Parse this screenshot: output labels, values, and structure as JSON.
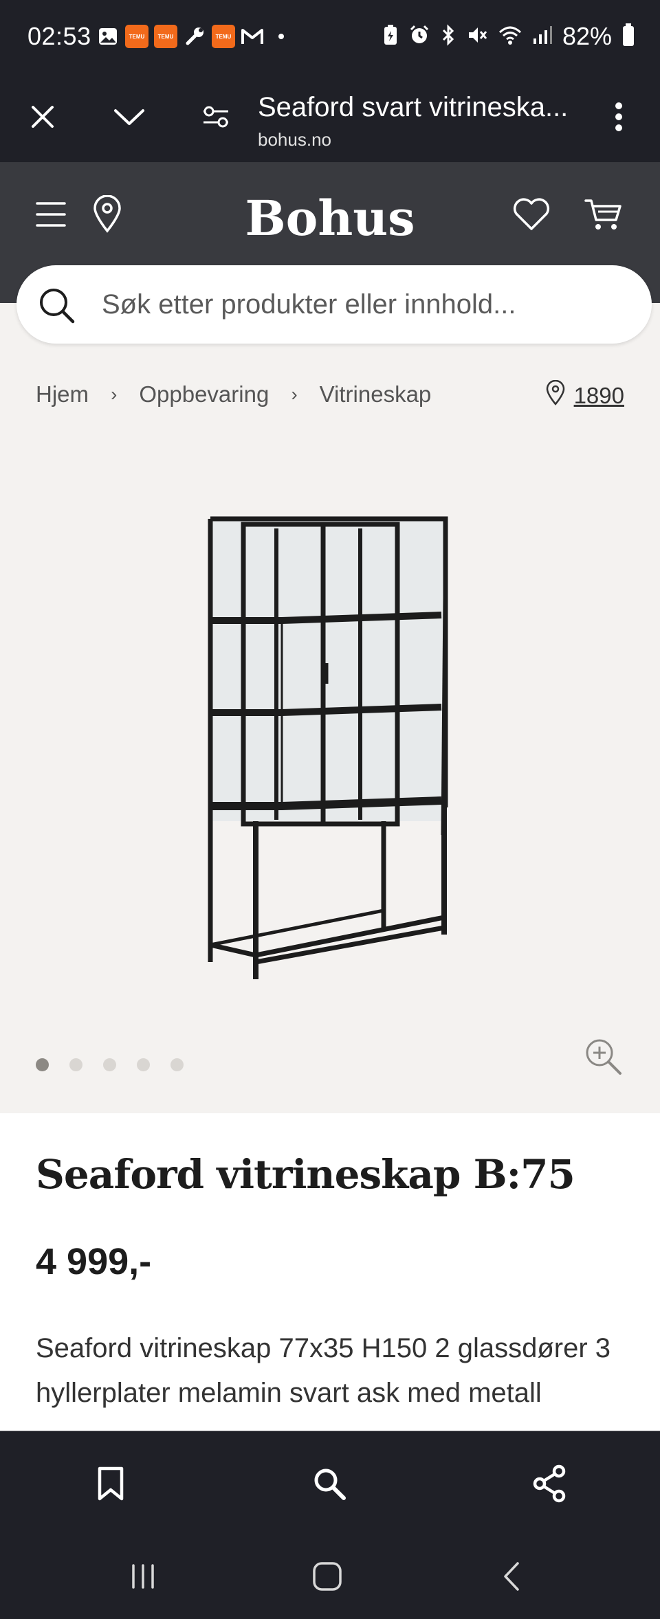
{
  "status_bar": {
    "time": "02:53",
    "battery": "82%",
    "notification_icons": [
      "gallery-icon",
      "temu-icon",
      "temu-icon",
      "wrench-icon",
      "temu-icon",
      "gmail-icon",
      "dot-icon"
    ],
    "temu_label": "TEMU",
    "status_icons": [
      "battery-saver-icon",
      "alarm-icon",
      "bluetooth-icon",
      "mute-icon",
      "wifi-icon",
      "signal-icon"
    ]
  },
  "browser": {
    "title": "Seaford svart vitrineska...",
    "url": "bohus.no"
  },
  "site": {
    "logo": "Bohus",
    "accent": "#393a3f"
  },
  "search": {
    "placeholder": "Søk etter produkter eller innhold..."
  },
  "breadcrumb": {
    "items": [
      "Hjem",
      "Oppbevaring",
      "Vitrineskap"
    ],
    "separator": "›",
    "store": "1890"
  },
  "gallery": {
    "image_count": 5,
    "active_index": 0
  },
  "product": {
    "title": "Seaford vitrineskap B:75",
    "price": "4 999,-",
    "description": "Seaford vitrineskap 77x35 H150 2 glassdører 3 hyllerplater melamin svart ask med metall"
  },
  "colors": {
    "dark_bar": "#1f2027",
    "page_bg": "#f4f2f0",
    "notif_temu": "#f26a1b"
  }
}
